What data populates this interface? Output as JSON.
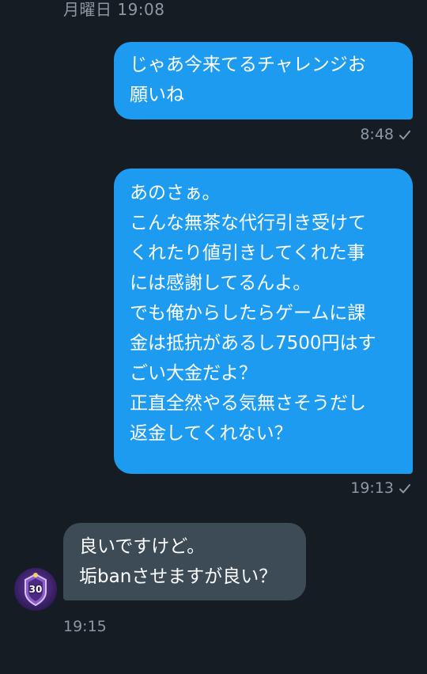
{
  "header": {
    "date_label": "月曜日 19:08"
  },
  "messages": [
    {
      "direction": "sent",
      "text": "じゃあ今来てるチャレンジお\n願いね",
      "time": "8:48",
      "status_icon": "check-icon"
    },
    {
      "direction": "sent",
      "text": "あのさぁ。\nこんな無茶な代行引き受けて\nくれたり値引きしてくれた事\nには感謝してるんよ。\nでも俺からしたらゲームに課\n金は抵抗があるし7500円はす\nごい大金だよ？\n正直全然やる気無さそうだし\n返金してくれない？",
      "time": "19:13",
      "status_icon": "check-icon"
    },
    {
      "direction": "received",
      "text": "良いですけど。\n垢banさせますが良い？",
      "time": "19:15",
      "avatar_level": "30"
    }
  ],
  "colors": {
    "background": "#151c23",
    "sent_bubble": "#1d9bf0",
    "received_bubble": "#3d4b57",
    "meta_text": "#8b98a5"
  }
}
